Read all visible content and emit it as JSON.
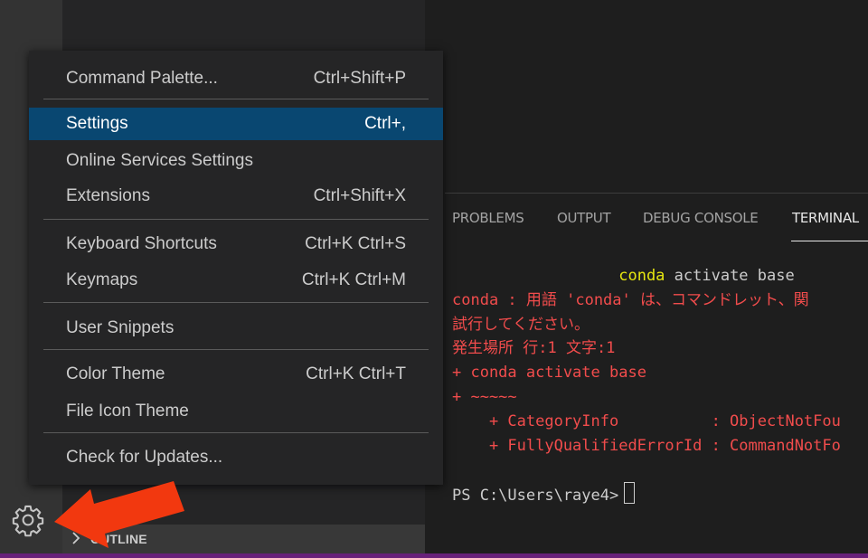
{
  "menu": {
    "items": [
      {
        "label": "Command Palette...",
        "shortcut": "Ctrl+Shift+P"
      },
      {
        "label": "Settings",
        "shortcut": "Ctrl+,"
      },
      {
        "label": "Online Services Settings",
        "shortcut": ""
      },
      {
        "label": "Extensions",
        "shortcut": "Ctrl+Shift+X"
      },
      {
        "label": "Keyboard Shortcuts",
        "shortcut": "Ctrl+K Ctrl+S"
      },
      {
        "label": "Keymaps",
        "shortcut": "Ctrl+K Ctrl+M"
      },
      {
        "label": "User Snippets",
        "shortcut": ""
      },
      {
        "label": "Color Theme",
        "shortcut": "Ctrl+K Ctrl+T"
      },
      {
        "label": "File Icon Theme",
        "shortcut": ""
      },
      {
        "label": "Check for Updates...",
        "shortcut": ""
      }
    ],
    "selected_index": 1
  },
  "panel": {
    "tabs": [
      {
        "label": "PROBLEMS"
      },
      {
        "label": "OUTPUT"
      },
      {
        "label": "DEBUG CONSOLE"
      },
      {
        "label": "TERMINAL"
      }
    ],
    "active_tab": "TERMINAL"
  },
  "terminal": {
    "lines": [
      {
        "kind": "cmd",
        "prefix": "                  ",
        "cmd": "conda",
        "rest": " activate base"
      },
      {
        "kind": "red",
        "text": "conda : 用語 'conda' は、コマンドレット、関"
      },
      {
        "kind": "red",
        "text": "試行してください。"
      },
      {
        "kind": "red",
        "text": "発生場所 行:1 文字:1"
      },
      {
        "kind": "red",
        "text": "+ conda activate base"
      },
      {
        "kind": "red",
        "text": "+ ~~~~~"
      },
      {
        "kind": "red",
        "text": "    + CategoryInfo          : ObjectNotFou"
      },
      {
        "kind": "red",
        "text": "    + FullyQualifiedErrorId : CommandNotFo"
      },
      {
        "kind": "blank",
        "text": ""
      },
      {
        "kind": "prompt",
        "text": "PS C:\\Users\\raye4>"
      }
    ]
  },
  "sidebar": {
    "outline_label": "OUTLINE"
  },
  "icons": {
    "manage": "gear-icon",
    "outline_toggle": "chevron-right-icon",
    "annotation": "arrow-icon"
  },
  "colors": {
    "selection": "#094771",
    "error_text": "#f14c4c",
    "command_highlight": "#e5e510",
    "annotation_arrow": "#f2380f",
    "status_bar": "#68217a"
  }
}
